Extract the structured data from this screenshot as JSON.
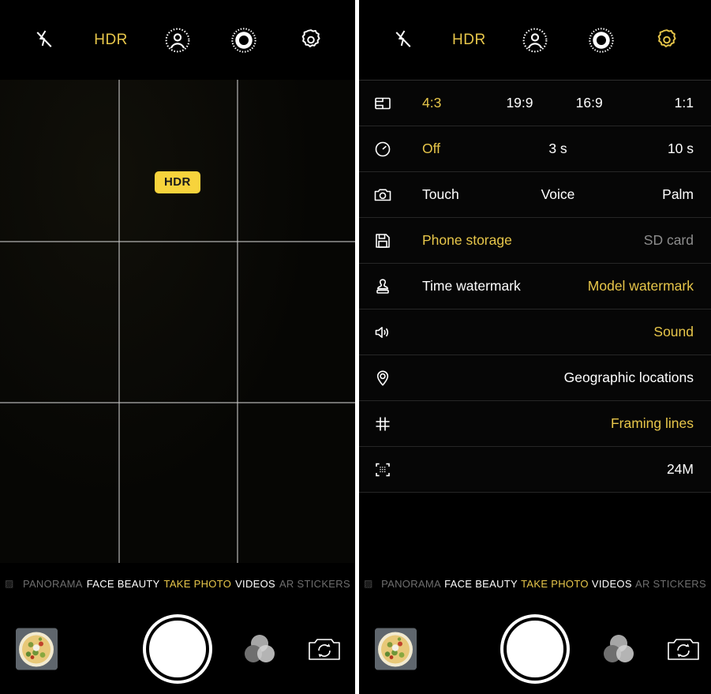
{
  "app": {
    "name": "Camera"
  },
  "colors": {
    "accent_yellow": "#e7c64a",
    "badge_yellow": "#f7d33c",
    "background": "#000000",
    "text_white": "#ffffff",
    "text_dim": "#8d8d8d",
    "grid_line": "rgba(200,200,200,0.55)"
  },
  "topbar": {
    "flash_off_icon": "flash-off-icon",
    "hdr_label": "HDR",
    "beauty_icon": "portrait-beauty-icon",
    "bokeh_icon": "aperture-bokeh-icon",
    "settings_icon": "gear-icon"
  },
  "viewfinder": {
    "hdr_badge": "HDR",
    "grid_enabled": true,
    "grid_columns": 3,
    "grid_rows": 3
  },
  "settings": {
    "rows": [
      {
        "icon": "aspect-ratio-icon",
        "name": "aspect-ratio",
        "layout": "opts-4",
        "options": [
          {
            "label": "4:3",
            "state": "selected"
          },
          {
            "label": "19:9",
            "state": "normal"
          },
          {
            "label": "16:9",
            "state": "normal"
          },
          {
            "label": "1:1",
            "state": "normal"
          }
        ]
      },
      {
        "icon": "timer-icon",
        "name": "timer",
        "layout": "opts-3",
        "options": [
          {
            "label": "Off",
            "state": "selected"
          },
          {
            "label": "3 s",
            "state": "normal"
          },
          {
            "label": "10 s",
            "state": "normal"
          }
        ]
      },
      {
        "icon": "camera-icon",
        "name": "shutter-mode",
        "layout": "opts-3",
        "options": [
          {
            "label": "Touch",
            "state": "normal"
          },
          {
            "label": "Voice",
            "state": "normal"
          },
          {
            "label": "Palm",
            "state": "normal"
          }
        ]
      },
      {
        "icon": "save-storage-icon",
        "name": "storage-location",
        "layout": "opts-2",
        "options": [
          {
            "label": "Phone storage",
            "state": "selected"
          },
          {
            "label": "SD card",
            "state": "dim"
          }
        ]
      },
      {
        "icon": "watermark-stamp-icon",
        "name": "watermark",
        "layout": "opts-2",
        "options": [
          {
            "label": "Time watermark",
            "state": "normal"
          },
          {
            "label": "Model watermark",
            "state": "selected"
          }
        ]
      },
      {
        "icon": "speaker-sound-icon",
        "name": "shutter-sound",
        "layout": "opts-1",
        "options": [
          {
            "label": "Sound",
            "state": "selected"
          }
        ]
      },
      {
        "icon": "location-pin-icon",
        "name": "geographic-locations",
        "layout": "opts-1",
        "options": [
          {
            "label": "Geographic locations",
            "state": "normal"
          }
        ]
      },
      {
        "icon": "grid-hash-icon",
        "name": "framing-lines",
        "layout": "opts-1",
        "options": [
          {
            "label": "Framing lines",
            "state": "selected"
          }
        ]
      },
      {
        "icon": "resolution-icon",
        "name": "resolution",
        "layout": "opts-1",
        "options": [
          {
            "label": "24M",
            "state": "normal"
          }
        ]
      }
    ]
  },
  "modebar": {
    "modes": [
      {
        "label": "PANORAMA",
        "state": "edge"
      },
      {
        "label": "FACE BEAUTY",
        "state": "normal"
      },
      {
        "label": "TAKE PHOTO",
        "state": "active"
      },
      {
        "label": "VIDEOS",
        "state": "normal"
      },
      {
        "label": "AR STICKERS",
        "state": "edge"
      }
    ]
  },
  "bottombar": {
    "gallery_thumbnail": "gallery-thumbnail-pizza",
    "shutter_button": "shutter-button",
    "filters_icon": "color-filters-icon",
    "flip_camera_icon": "flip-camera-icon"
  }
}
